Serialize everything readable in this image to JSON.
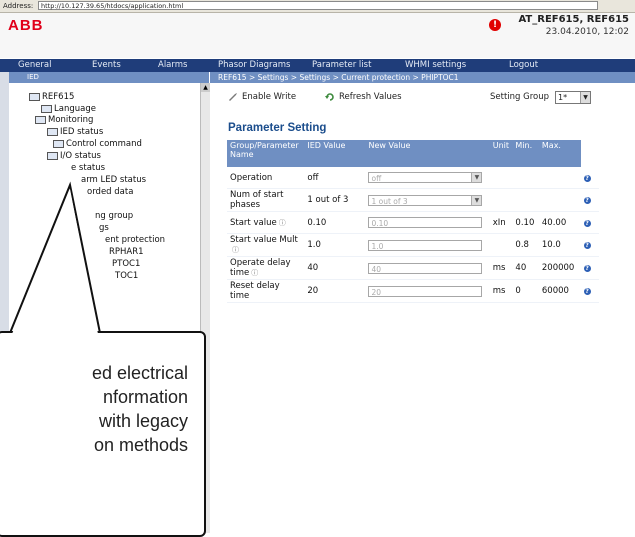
{
  "address": {
    "label": "Address:",
    "url": "http://10.127.39.65/htdocs/application.html"
  },
  "header": {
    "logo": "ABB",
    "alert_icon": "alert-icon",
    "device": "AT_REF615, REF615",
    "datetime": "23.04.2010, 12:02"
  },
  "menu": [
    "General",
    "Events",
    "Alarms",
    "Phasor Diagrams",
    "Parameter list",
    "WHMI settings",
    "Logout"
  ],
  "left_panel": {
    "title": "IED"
  },
  "tree": [
    "REF615",
    "Language",
    "Monitoring",
    "IED status",
    "Control command",
    "I/O status",
    "e status",
    "arm LED status",
    "orded data",
    "ng group",
    "gs",
    "ent protection",
    "RPHAR1",
    "PTOC1",
    "TOC1"
  ],
  "breadcrumb": "REF615 > Settings > Settings > Current protection > PHIPTOC1",
  "toolbar": {
    "enable_write": "Enable Write",
    "refresh": "Refresh Values",
    "setting_group_label": "Setting Group",
    "setting_group_value": "1*"
  },
  "page_title": "Parameter Setting",
  "table": {
    "headers": [
      "Group/Parameter Name",
      "IED Value",
      "New Value",
      "Unit",
      "Min.",
      "Max."
    ],
    "rows": [
      {
        "name": "Operation",
        "ied": "off",
        "new": "off",
        "unit": "",
        "min": "",
        "max": ""
      },
      {
        "name": "Num of start phases",
        "ied": "1 out of 3",
        "new": "1 out of 3",
        "unit": "",
        "min": "",
        "max": ""
      },
      {
        "name": "Start value",
        "ied": "0.10",
        "new": "0.10",
        "unit": "xIn",
        "min": "0.10",
        "max": "40.00"
      },
      {
        "name": "Start value Mult",
        "ied": "1.0",
        "new": "1.0",
        "unit": "",
        "min": "0.8",
        "max": "10.0"
      },
      {
        "name": "Operate delay time",
        "ied": "40",
        "new": "40",
        "unit": "ms",
        "min": "40",
        "max": "200000"
      },
      {
        "name": "Reset delay time",
        "ied": "20",
        "new": "20",
        "unit": "ms",
        "min": "0",
        "max": "60000"
      }
    ]
  },
  "callout": {
    "text": "ed electrical\nnformation\nwith legacy\non methods"
  }
}
